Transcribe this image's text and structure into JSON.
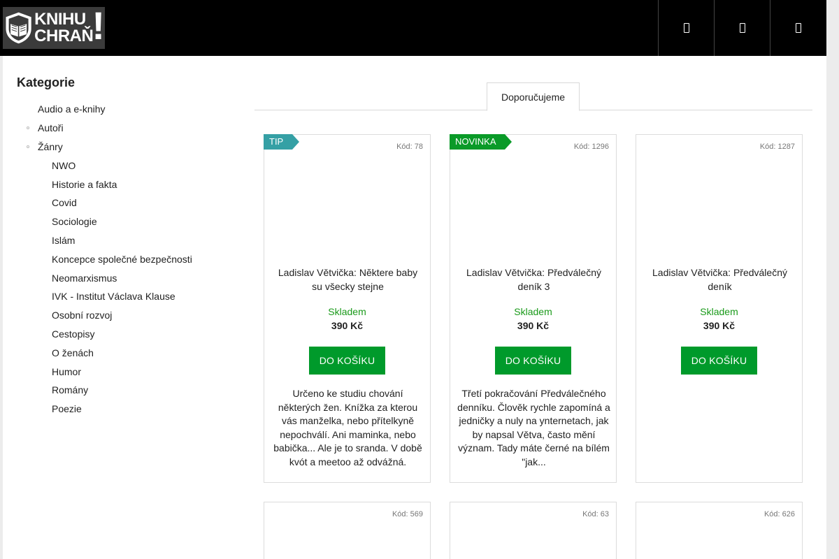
{
  "header": {
    "logo": {
      "line1": "KNIHU",
      "line2": "CHRAŇ",
      "bang": "!"
    },
    "buttons": [
      {
        "name": "search-icon"
      },
      {
        "name": "user-icon"
      },
      {
        "name": "cart-icon"
      }
    ]
  },
  "sidebar": {
    "title": "Kategorie",
    "items": [
      {
        "label": "Audio a e-knihy",
        "level": 1,
        "bullet": false
      },
      {
        "label": "Autoři",
        "level": 1,
        "bullet": true
      },
      {
        "label": "Žánry",
        "level": 1,
        "bullet": true
      },
      {
        "label": "NWO",
        "level": 2
      },
      {
        "label": "Historie a fakta",
        "level": 2
      },
      {
        "label": "Covid",
        "level": 2
      },
      {
        "label": "Sociologie",
        "level": 2
      },
      {
        "label": "Islám",
        "level": 2
      },
      {
        "label": "Koncepce společné bezpečnosti",
        "level": 2
      },
      {
        "label": "Neomarxismus",
        "level": 2
      },
      {
        "label": "IVK - Institut Václava Klause",
        "level": 2
      },
      {
        "label": "Osobní rozvoj",
        "level": 2
      },
      {
        "label": "Cestopisy",
        "level": 2
      },
      {
        "label": "O ženách",
        "level": 2
      },
      {
        "label": "Humor",
        "level": 2
      },
      {
        "label": "Romány",
        "level": 2
      },
      {
        "label": "Poezie",
        "level": 2
      }
    ]
  },
  "tabs": {
    "active": "Doporučujeme"
  },
  "products": [
    {
      "badge": "TIP",
      "code": "Kód: 78",
      "name": "Ladislav Větvička: Nĕktere baby su všecky stejne",
      "stock": "Skladem",
      "price": "390 Kč",
      "cart": "DO KOŠÍKU",
      "desc": "Určeno ke studiu chování některých žen. Knížka za kterou vás manželka, nebo přítelkyně nepochválí. Ani maminka, nebo babička... Ale je to sranda. V době kvót a meetoo až odvážná."
    },
    {
      "badge": "NOVINKA",
      "code": "Kód: 1296",
      "name": "Ladislav Větvička: Předválečný deník 3",
      "stock": "Skladem",
      "price": "390 Kč",
      "cart": "DO KOŠÍKU",
      "desc": "Třetí pokračování Předválečného denníku.  Člověk rychle zapomíná a jedničky a nuly na ynternetach, jak by napsal Větva, často mění význam. Tady máte černé na bílém \"jak..."
    },
    {
      "badge": "",
      "code": "Kód: 1287",
      "name": "Ladislav Větvička: Předválečný deník",
      "stock": "Skladem",
      "price": "390 Kč",
      "cart": "DO KOŠÍKU",
      "desc": ""
    },
    {
      "code": "Kód: 569"
    },
    {
      "code": "Kód: 63"
    },
    {
      "code": "Kód: 626"
    }
  ]
}
